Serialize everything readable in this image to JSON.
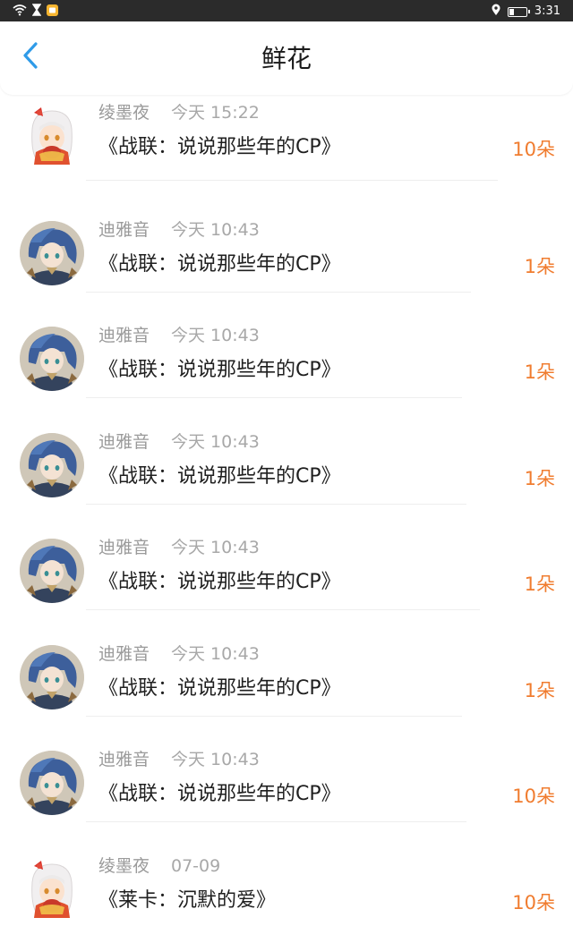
{
  "status_bar": {
    "time": "3:31",
    "battery_level": 0.3,
    "icons": [
      "wifi-icon",
      "hourglass-icon",
      "notification-icon",
      "location-icon",
      "battery-icon"
    ]
  },
  "header": {
    "title": "鲜花",
    "back_icon": "chevron-left-icon",
    "accent_color": "#2f9be8"
  },
  "colors": {
    "count": "#f07c2f",
    "name": "#9a9a9a",
    "title": "#1f1f1f"
  },
  "flowers": [
    {
      "name": "绫墨夜",
      "time": "今天 15:22",
      "title": "《战联：说说那些年的CP》",
      "count": "10朵",
      "avatar": "white-hair-girl"
    },
    {
      "name": "迪雅音",
      "time": "今天 10:43",
      "title": "《战联：说说那些年的CP》",
      "count": "1朵",
      "avatar": "blue-hair-boy"
    },
    {
      "name": "迪雅音",
      "time": "今天 10:43",
      "title": "《战联：说说那些年的CP》",
      "count": "1朵",
      "avatar": "blue-hair-boy"
    },
    {
      "name": "迪雅音",
      "time": "今天 10:43",
      "title": "《战联：说说那些年的CP》",
      "count": "1朵",
      "avatar": "blue-hair-boy"
    },
    {
      "name": "迪雅音",
      "time": "今天 10:43",
      "title": "《战联：说说那些年的CP》",
      "count": "1朵",
      "avatar": "blue-hair-boy"
    },
    {
      "name": "迪雅音",
      "time": "今天 10:43",
      "title": "《战联：说说那些年的CP》",
      "count": "1朵",
      "avatar": "blue-hair-boy"
    },
    {
      "name": "迪雅音",
      "time": "今天 10:43",
      "title": "《战联：说说那些年的CP》",
      "count": "10朵",
      "avatar": "blue-hair-boy"
    },
    {
      "name": "绫墨夜",
      "time": "07-09",
      "title": "《莱卡：沉默的爱》",
      "count": "10朵",
      "avatar": "white-hair-girl"
    }
  ]
}
